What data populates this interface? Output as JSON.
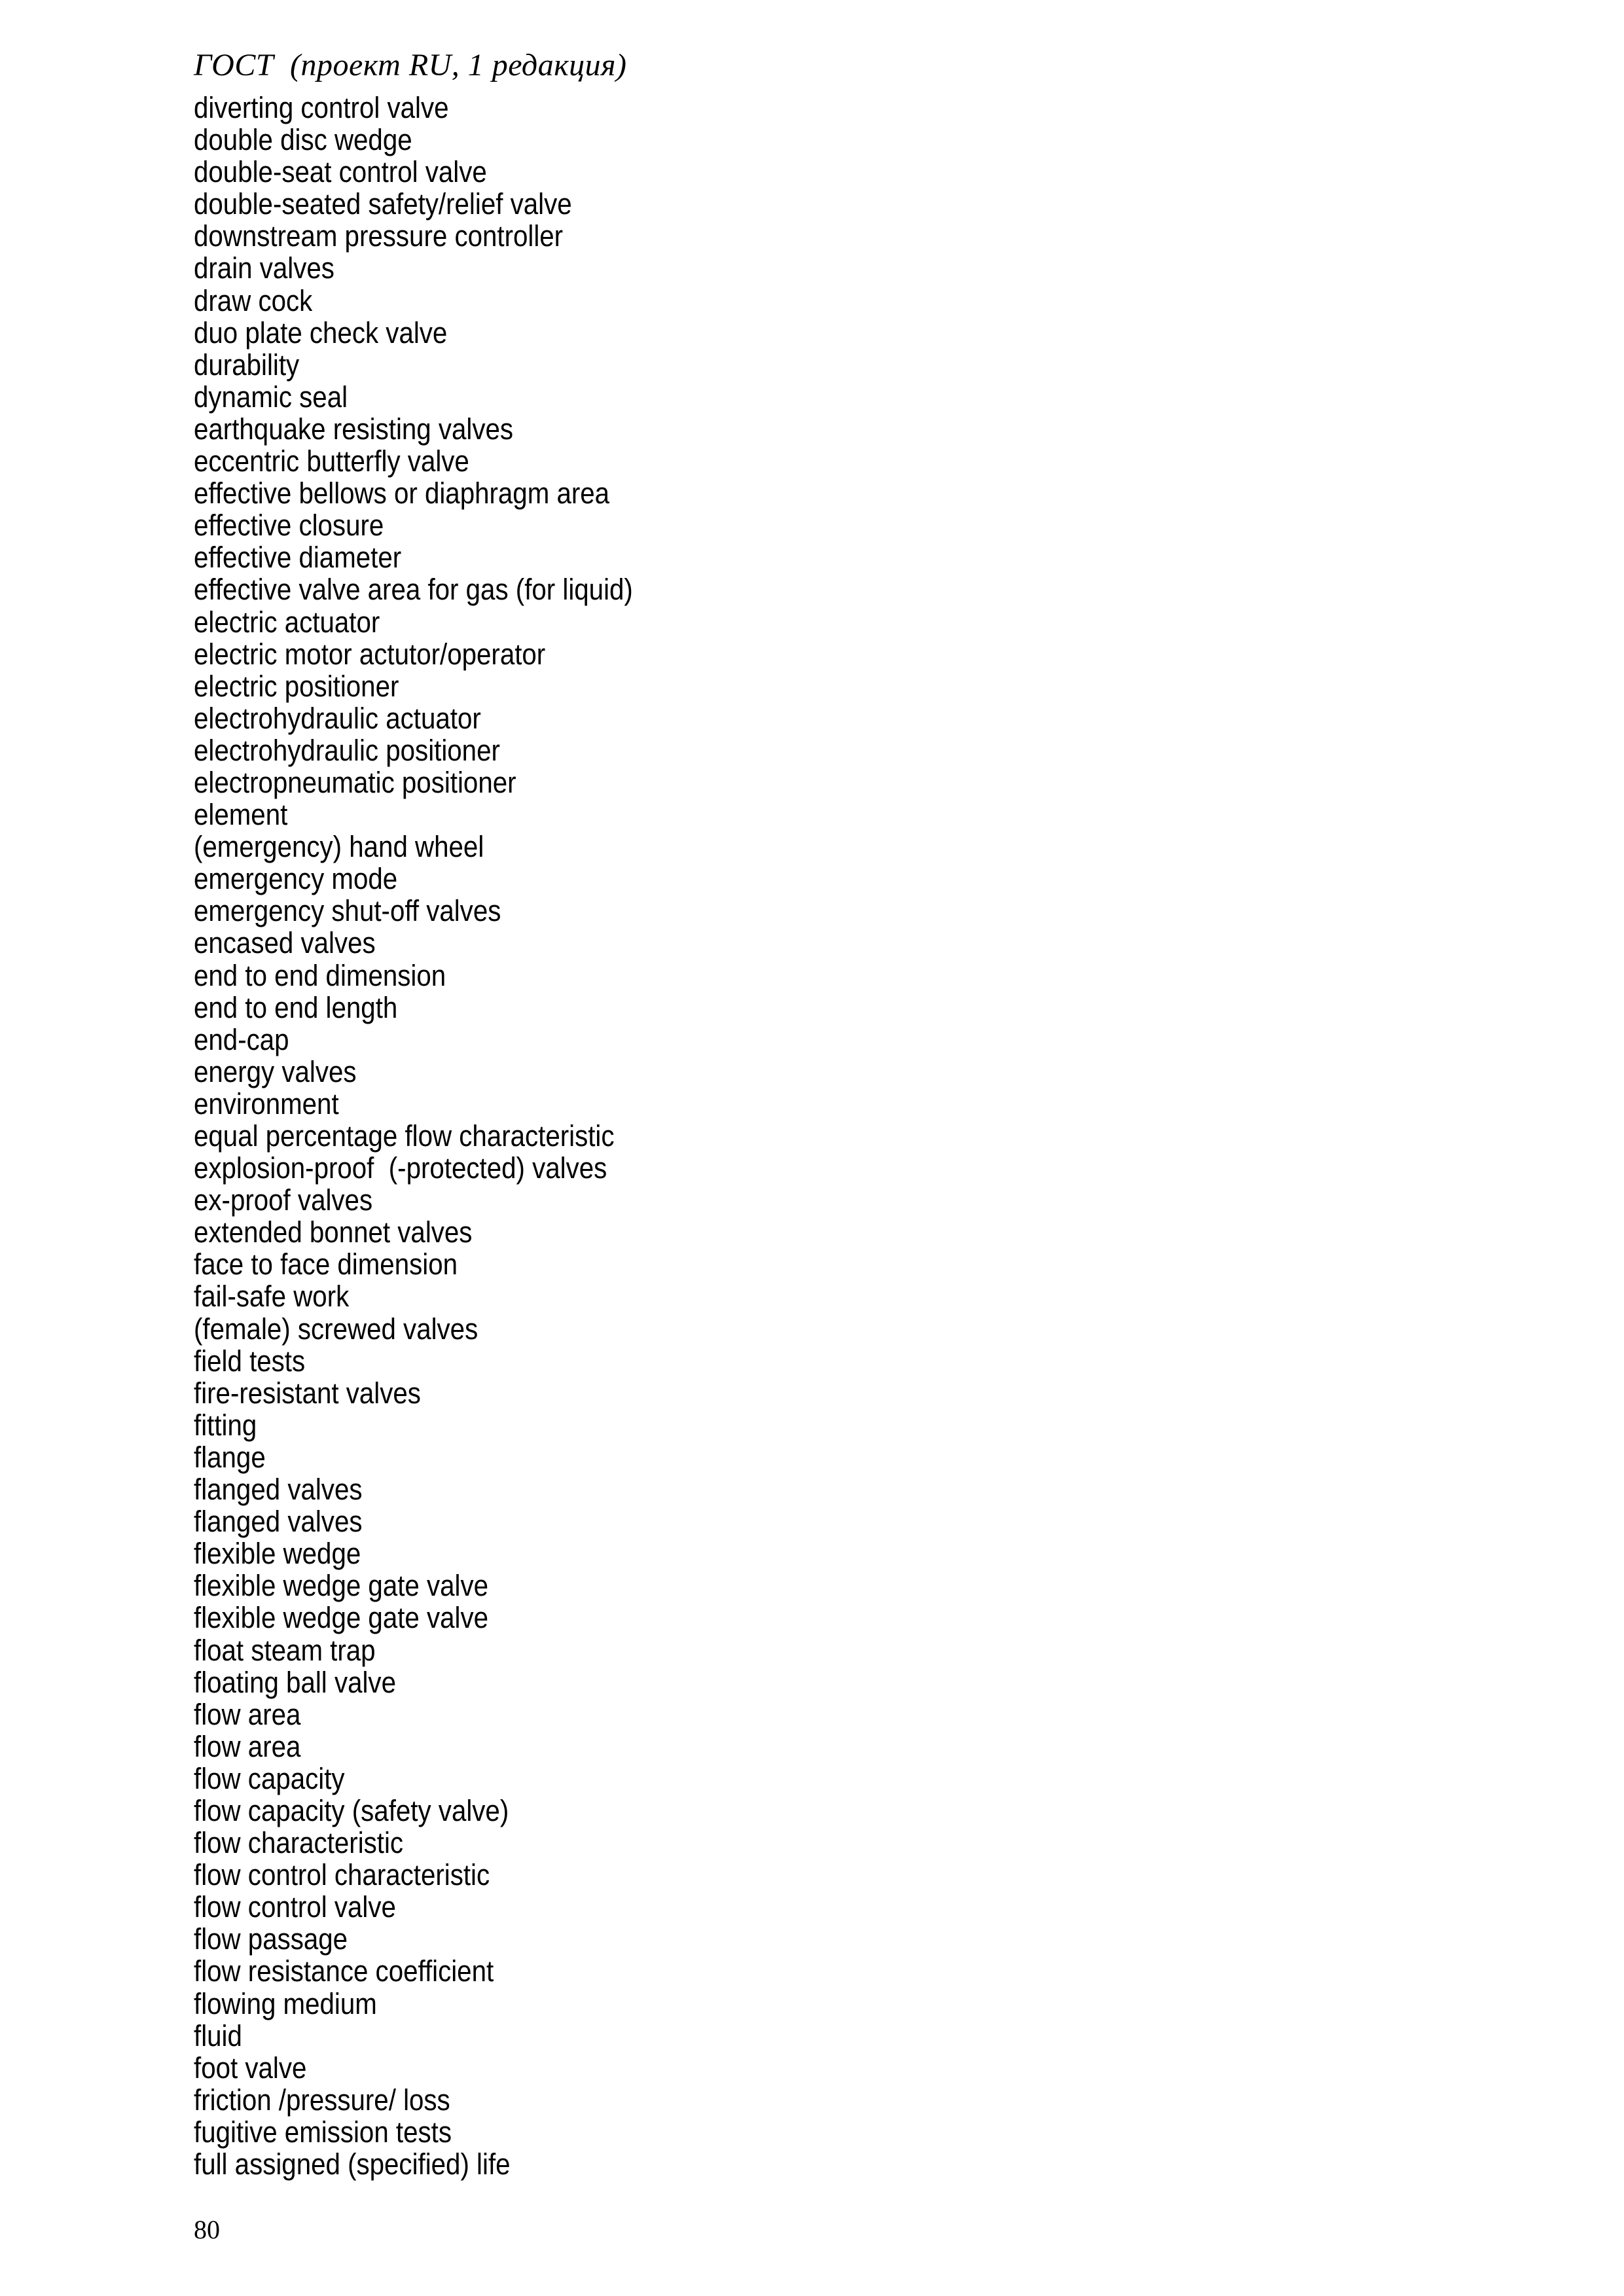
{
  "document": {
    "running_head": "ГОСТ  (проект RU, 1 редакция)",
    "page_number": "80",
    "text_color": "#000000",
    "background_color": "#ffffff"
  },
  "glossary": {
    "terms": [
      "diverting control valve",
      "double disc wedge",
      "double-seat control valve",
      "double-seated safety/relief valve",
      "downstream pressure controller",
      "drain valves",
      "draw cock",
      "duo plate check valve",
      "durability",
      "dynamic seal",
      "earthquake resisting valves",
      "eccentric butterfly valve",
      "effective bellows or diaphragm area",
      "effective closure",
      "effective diameter",
      "effective valve area for gas (for liquid)",
      "electric actuator",
      "electric motor actutor/operator",
      "electric positioner",
      "electrohydraulic actuator",
      "electrohydraulic positioner",
      "electropneumatic positioner",
      "element",
      "(emergency) hand wheel",
      "emergency mode",
      "emergency shut-off valves",
      "encased valves",
      "end to end dimension",
      "end to end length",
      "end-cap",
      "energy valves",
      "environment",
      "equal percentage flow characteristic",
      "explosion-proof  (-protected) valves",
      "ex-proof valves",
      "extended bonnet valves",
      "face to face dimension",
      "fail-safe work",
      "(female) screwed valves",
      "field tests",
      "fire-resistant valves",
      "fitting",
      "flange",
      "flanged valves",
      "flanged valves",
      "flexible wedge",
      "flexible wedge gate valve",
      "flexible wedge gate valve",
      "float steam trap",
      "floating ball valve",
      "flow area",
      "flow area",
      "flow capacity",
      "flow capacity (safety valve)",
      "flow characteristic",
      "flow control characteristic",
      "flow control valve",
      "flow passage",
      "flow resistance coefficient",
      "flowing medium",
      "fluid",
      "foot valve",
      "friction /pressure/ loss",
      "fugitive emission tests",
      "full assigned (specified) life"
    ]
  }
}
